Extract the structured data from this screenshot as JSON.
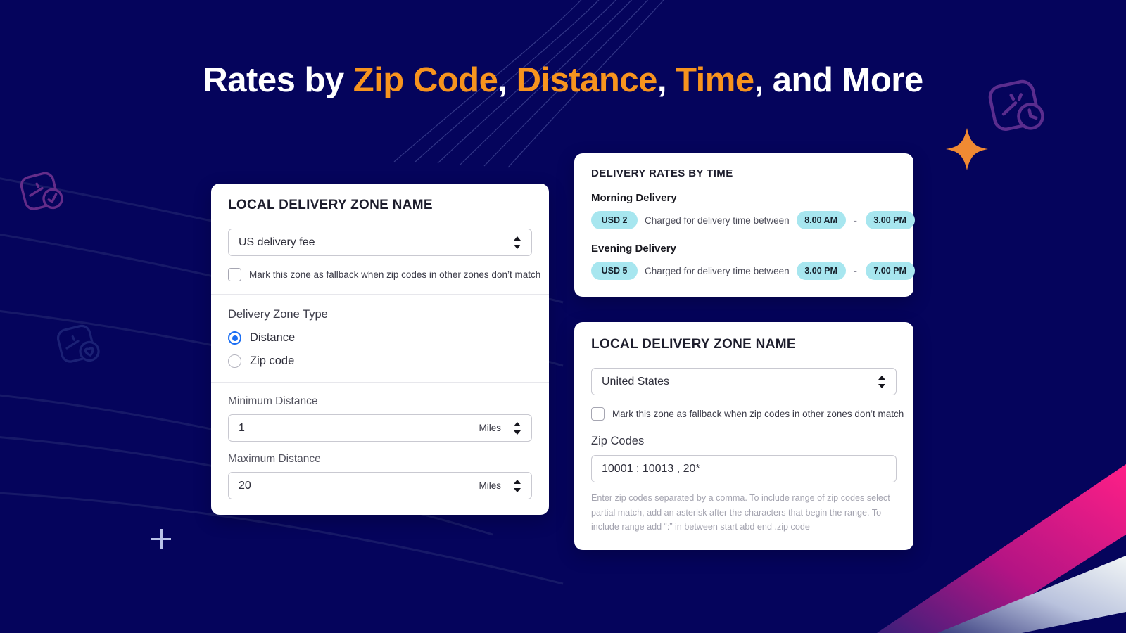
{
  "page": {
    "background_color": "#05045c",
    "accent_color": "#f7941e",
    "pill_color": "#a7e6ef",
    "radio_color": "#1b6ef3"
  },
  "headline": {
    "part1": "Rates by ",
    "accent1": "Zip Code",
    "sep1": ", ",
    "accent2": "Distance",
    "sep2": ", ",
    "accent3": "Time",
    "part2": ", and More"
  },
  "distance_card": {
    "title": "LOCAL DELIVERY ZONE NAME",
    "zone_select_value": "US delivery fee",
    "fallback_checkbox_label": "Mark this zone as fallback when zip codes in other zones don’t match",
    "zone_type_label": "Delivery Zone Type",
    "zone_type_options": [
      {
        "label": "Distance",
        "selected": true
      },
      {
        "label": "Zip code",
        "selected": false
      }
    ],
    "minimum_distance_label": "Minimum Distance",
    "minimum_distance_value": "1",
    "minimum_distance_unit": "Miles",
    "maximum_distance_label": "Maximum Distance",
    "maximum_distance_value": "20",
    "maximum_distance_unit": "Miles"
  },
  "rates_time_card": {
    "title": "DELIVERY RATES BY TIME",
    "rows": [
      {
        "heading": "Morning Delivery",
        "amount": "USD 2",
        "text": "Charged for delivery time between",
        "start": "8.00 AM",
        "dash": "-",
        "end": "3.00 PM"
      },
      {
        "heading": "Evening Delivery",
        "amount": "USD 5",
        "text": "Charged for delivery time between",
        "start": "3.00 PM",
        "dash": "-",
        "end": "7.00 PM"
      }
    ]
  },
  "zip_card": {
    "title": "LOCAL DELIVERY ZONE NAME",
    "country_select_value": "United States",
    "fallback_checkbox_label": "Mark this zone as fallback when zip codes in other zones don’t match",
    "zip_codes_label": "Zip Codes",
    "zip_codes_value": "10001 : 10013 , 20*",
    "helper_text": "Enter zip codes separated by a comma. To include range of zip codes select partial match, add an asterisk after the characters that begin the range. To include range add “:” in between start abd end .zip code"
  },
  "decor": {
    "sparkle": "sparkle-icon",
    "crosshair": "crosshair-cursor",
    "badge_top_right": "delivery-clock-badge-icon",
    "badge_left_upper": "delivery-check-badge-icon",
    "badge_left_lower": "delivery-heart-badge-icon"
  }
}
